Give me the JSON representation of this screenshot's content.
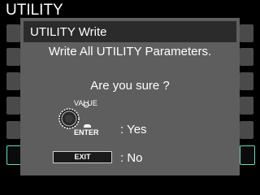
{
  "screen": {
    "title": "UTILITY"
  },
  "dialog": {
    "title": "UTILITY Write",
    "message": "Write All UTILITY Parameters.",
    "prompt": "Are you sure ?",
    "knob_label": "VALUE",
    "enter_label": "ENTER",
    "yes_text": ": Yes",
    "exit_label": "EXIT",
    "no_text": ": No"
  },
  "colors": {
    "background": "#000000",
    "dialog": "#5e5e5e",
    "dialog_header": "#2b2b2b",
    "selection_outline": "#5fdcc0"
  },
  "icons": {
    "knob": "value-knob-icon",
    "enter": "enter-button-icon"
  }
}
